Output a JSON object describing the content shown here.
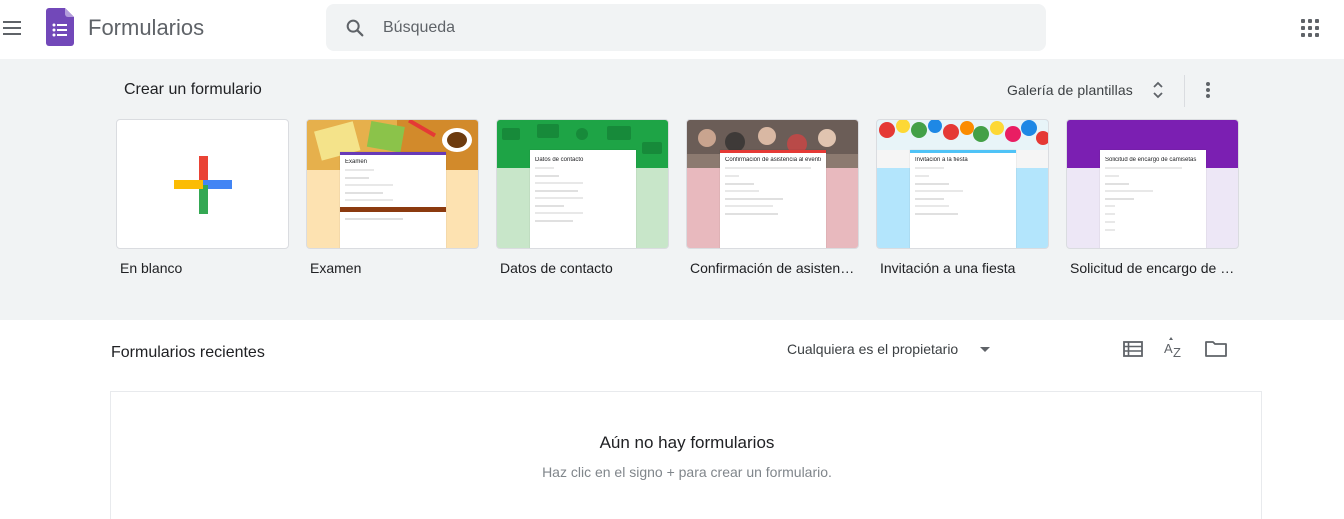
{
  "header": {
    "app_title": "Formularios",
    "search_placeholder": "Búsqueda",
    "menu_icon": "hamburger-menu-icon",
    "apps_icon": "apps-grid-icon",
    "brand_color": "#673ab7"
  },
  "templates": {
    "section_title": "Crear un formulario",
    "gallery_label": "Galería de plantillas",
    "items": [
      {
        "label": "En blanco"
      },
      {
        "label": "Examen",
        "form_title": "Examen"
      },
      {
        "label": "Datos de contacto",
        "form_title": "Datos de contacto"
      },
      {
        "label": "Confirmación de asistencia al evento",
        "form_title": "Confirmación de asistencia al evento"
      },
      {
        "label": "Invitación a una fiesta",
        "form_title": "Invitación a la fiesta"
      },
      {
        "label": "Solicitud de encargo de camisetas",
        "form_title": "Solicitud de encargo de camisetas"
      }
    ]
  },
  "recent": {
    "title": "Formularios recientes",
    "owner_filter": "Cualquiera es el propietario",
    "empty_title": "Aún no hay formularios",
    "empty_subtitle": "Haz clic en el signo + para crear un formulario."
  }
}
